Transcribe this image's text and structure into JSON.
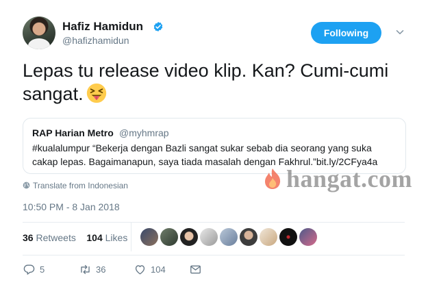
{
  "author": {
    "name": "Hafiz Hamidun",
    "handle": "@hafizhamidun",
    "verified": true
  },
  "follow_button": {
    "label": "Following"
  },
  "tweet": {
    "text": "Lepas tu release video klip. Kan? Cumi-cumi sangat.",
    "emoji": "face-with-stuck-out-tongue-and-winking-eye"
  },
  "quote": {
    "name": "RAP Harian Metro",
    "handle": "@myhmrap",
    "text": "#kualalumpur “Bekerja dengan Bazli sangat sukar sebab dia seorang yang suka cakap lepas. Bagaimanapun, saya tiada masalah dengan Fakhrul.”bit.ly/2CFya4a"
  },
  "translate": {
    "label": "Translate from Indonesian"
  },
  "watermark": {
    "text": "hangat.com"
  },
  "timestamp": "10:50 PM - 8 Jan 2018",
  "stats": {
    "retweets_count": "36",
    "retweets_label": "Retweets",
    "likes_count": "104",
    "likes_label": "Likes"
  },
  "actions": {
    "reply_count": "5",
    "retweet_count": "36",
    "like_count": "104"
  },
  "colors": {
    "accent": "#1da1f2",
    "text": "#14171a",
    "secondary": "#657786",
    "border": "#e1e8ed"
  }
}
